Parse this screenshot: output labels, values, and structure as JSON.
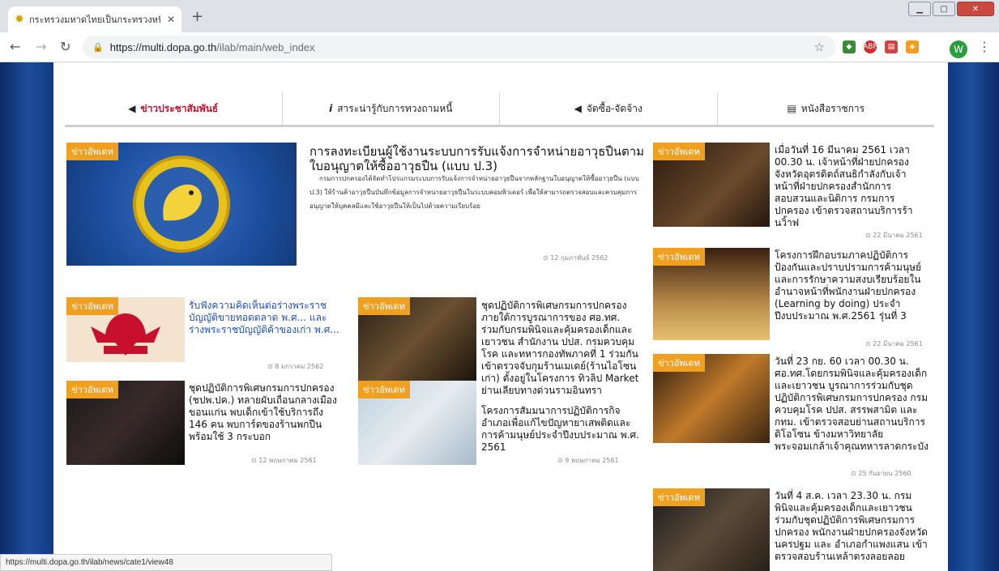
{
  "browser": {
    "tab_title": "กระทรวงมหาดไทยเป็นกระทรวงหนึ่งใ",
    "url_domain": "https://multi.dopa.go.th",
    "url_path": "/ilab/main/web_index",
    "profile_initial": "W",
    "status_url": "https://multi.dopa.go.th/ilab/news/cate1/view48"
  },
  "menu": [
    {
      "label": "ข่าวประชาสัมพันธ์",
      "icon": "megaphone-icon",
      "active": true
    },
    {
      "label": "สาระน่ารู้กับการทวงถามหนี้",
      "icon": "info-icon",
      "active": false
    },
    {
      "label": "จัดซื้อ-จัดจ้าง",
      "icon": "megaphone-icon",
      "active": false
    },
    {
      "label": "หนังสือราชการ",
      "icon": "book-icon",
      "active": false
    }
  ],
  "tag_label": "ข่าวอัพเดท",
  "featured": {
    "title": "การลงทะเบียนผู้ใช้งานระบบการรับแจ้งการจำหน่ายอาวุธปืนตามใบอนุญาตให้ซื้ออาวุธปืน (แบบ ป.3)",
    "lede": "กรมการปกครองได้จัดทำโปรแกรมระบบการรับแจ้งการจำหน่ายอาวุธปืนจากหลักฐานใบอนุญาตให้ซื้ออาวุธปืน (แบบ ป.3) ให้ร้านค้าอาวุธปืนบันทึกข้อมูลการจำหน่ายอาวุธปืนในระบบคอมพิวเตอร์ เพื่อให้สามารถตรวจสอบและควบคุมการอนุญาตให้บุคคลมีและใช้อาวุธปืนให้เป็นไปด้วยความเรียบร้อย",
    "date": "⊙ 12 กุมภาพันธ์ 2562"
  },
  "cards": {
    "c1": {
      "title": "รับฟังความคิดเห็นต่อร่างพระราชบัญญัติขายทอดตลาด พ.ศ... และร่างพระราชบัญญัติค้าของเก่า พ.ศ...",
      "date": "⊙ 8 มกราคม 2562"
    },
    "c2": {
      "title": "ชุดปฏิบัติการพิเศษกรมการปกครอง ภายใต้การบูรณาการของ ศอ.ทศ. ร่วมกับกรมพินิจและคุ้มครองเด็กและเยาวชน สำนักงาน ปปส. กรมควบคุมโรค และทหารกองทัพภาคที่ 1 ร่วมกันเข้าตรวจจับกุมร้านเมเดย์(ร้านไอโซนเก่า) ตั้งอยู่ในโครงการ ทิวลิป Market ย่านเลียบทางด่วนรามอินทรา",
      "date": "⊙ 9 พฤษภาคม 2561"
    },
    "c3": {
      "title": "ชุดปฏิบัติการพิเศษกรมการปกครอง (ชปพ.ปค.) ทลายผับเถื่อนกลางเมืองขอนแก่น พบเด็กเข้าใช้บริการถึง 146 คน พบการ์ดของร้านพกปืนพร้อมใช้ 3 กระบอก",
      "date": "⊙ 12 พฤษภาคม 2561"
    },
    "c4": {
      "title": "โครงการสัมมนาการปฏิบัติการกิจอำเภอเพื่อแก้ไขปัญหายาเสพติดและการค้ามนุษย์ประจำปีงบประมาณ พ.ศ. 2561",
      "date": ""
    },
    "r1": {
      "title": "เมื่อวันที่ 16 มีนาคม 2561 เวลา 00.30 น. เจ้าหน้าที่ฝ่ายปกครองจังหวัดอุตรดิตถ์สนธิกำลังกับเจ้าหน้าที่ฝ่ายปกครองสำนักการสอบสวนและนิติการ กรมการปกครอง เข้าตรวจสถานบริการร้านวิ้าฟ",
      "date": "⊙ 22 มีนาคม 2561"
    },
    "r2": {
      "title": "โครงการฝึกอบรมภาคปฏิบัติการป้องกันและปราบปรามการค้ามนุษย์และการรักษาความสงบเรียบร้อยในอำนาจหน้าที่พนักงานฝ่ายปกครอง (Learning by doing) ประจำปีงบประมาณ พ.ศ.2561 รุ่นที่ 3",
      "date": "⊙ 22 มีนาคม 2561"
    },
    "r3": {
      "title": "วันที่ 23 กย. 60 เวลา 00.30 น. ศอ.ทศ.โดยกรมพินิจและคุ้มครองเด็กและเยาวชน บูรณาการร่วมกับชุดปฏิบัติการพิเศษกรมการปกครอง กรมควบคุมโรค ปปส. สรรพสามิต และ กทม. เข้าตรวจสอบย่านสถานบริการดิโอโซน ข้างมหาวิทยาลัยพระจอมเกล้าเจ้าคุณทหารลาดกระบัง",
      "date": "⊙ 25 กันยายน 2560"
    },
    "r4": {
      "title": "วันที่ 4 ส.ค. เวลา 23.30 น. กรมพินิจและคุ้มครองเด็กและเยาวชน ร่วมกับชุดปฏิบัติการพิเศษกรมการปกครอง พนักงานฝ่ายปกครองจังหวัดนครปฐม และ อำเภอกำแพงแสน เข้าตรวจสอบร้านเหล้าตรงลอยลอย",
      "date": ""
    }
  },
  "colors": {
    "accent": "#c8102e",
    "tag": "#f0a020",
    "link": "#1f4fbf"
  }
}
